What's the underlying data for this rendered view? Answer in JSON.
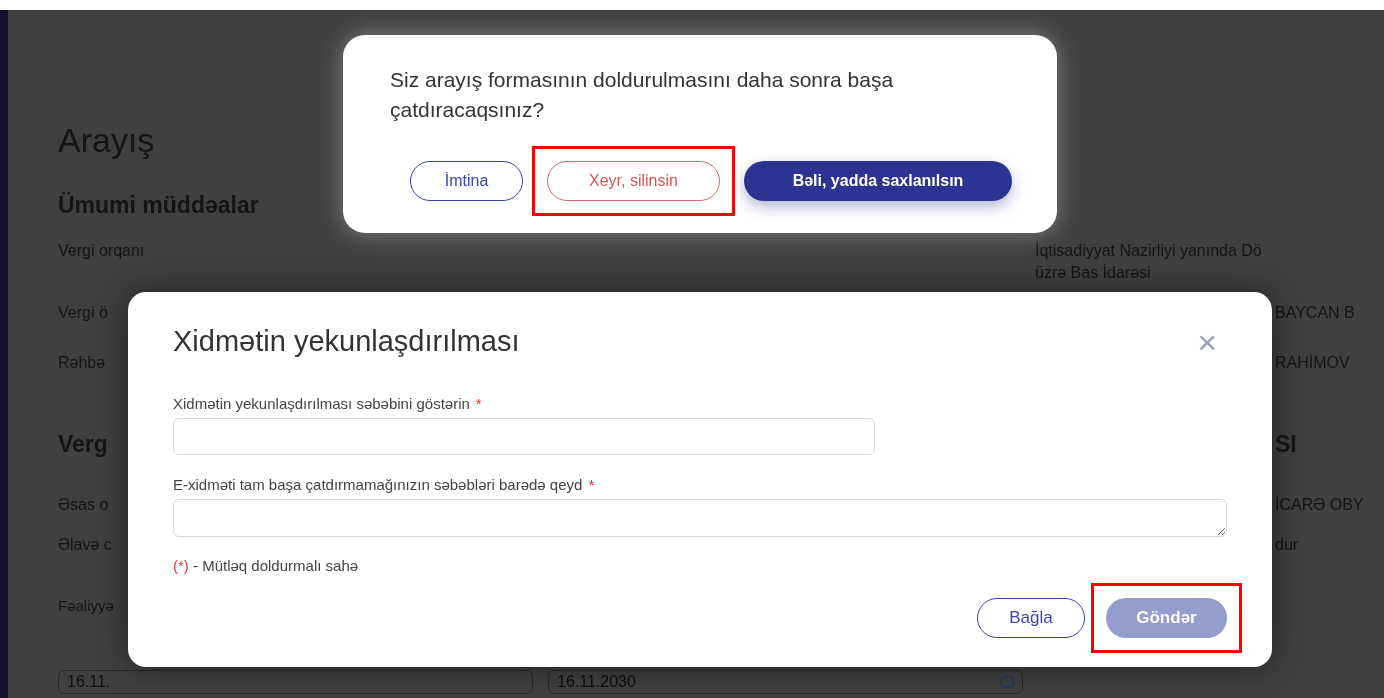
{
  "background_page": {
    "title": "Arayış",
    "section_1": "Ümumi müddəalar",
    "tax_authority": {
      "label": "Vergi orqanı",
      "value_lines": [
        "İqtisadiyyat Nazirliyi yanında Dö",
        "üzrə Bas İdarəsi"
      ]
    },
    "rows_1": [
      {
        "label": "Vergi ö",
        "value": "BAYCAN B"
      },
      {
        "label": "Rəhbə",
        "value": "RAHİMOV"
      }
    ],
    "section_2": {
      "left": "Verg",
      "right": "SI"
    },
    "rows_2": [
      {
        "label": "Əsas o",
        "value": "İCARƏ OBY"
      },
      {
        "label": "Əlavə c",
        "value": "dur"
      }
    ],
    "date_label": "Fəaliyyə",
    "dates": [
      "16.11.",
      "16.11.2030"
    ]
  },
  "confirm_dialog": {
    "message": "Siz arayış formasının doldurulmasını daha sonra başa çatdıracaqsınız?",
    "buttons": [
      {
        "label": "İmtina",
        "kind": "outline",
        "highlighted": false
      },
      {
        "label": "Xeyr, silinsin",
        "kind": "danger",
        "highlighted": true
      },
      {
        "label": "Bəli, yadda saxlanılsın",
        "kind": "primary",
        "highlighted": false
      }
    ]
  },
  "finish_dialog": {
    "title": "Xidmətin yekunlaşdırılması",
    "close": "×",
    "fields": [
      {
        "label": "Xidmətin yekunlaşdırılması səbəbini göstərin",
        "required": true,
        "kind": "input"
      },
      {
        "label": "E-xidməti tam başa çatdırmamağınızın səbəbləri barədə qeyd",
        "required": true,
        "kind": "textarea"
      }
    ],
    "required_mark": "*",
    "note": "(*) - Mütləq doldurmalı sahə",
    "buttons": [
      {
        "label": "Bağla",
        "kind": "outline",
        "disabled": false,
        "highlighted": false
      },
      {
        "label": "Göndər",
        "kind": "primary",
        "disabled": true,
        "highlighted": true
      }
    ]
  }
}
